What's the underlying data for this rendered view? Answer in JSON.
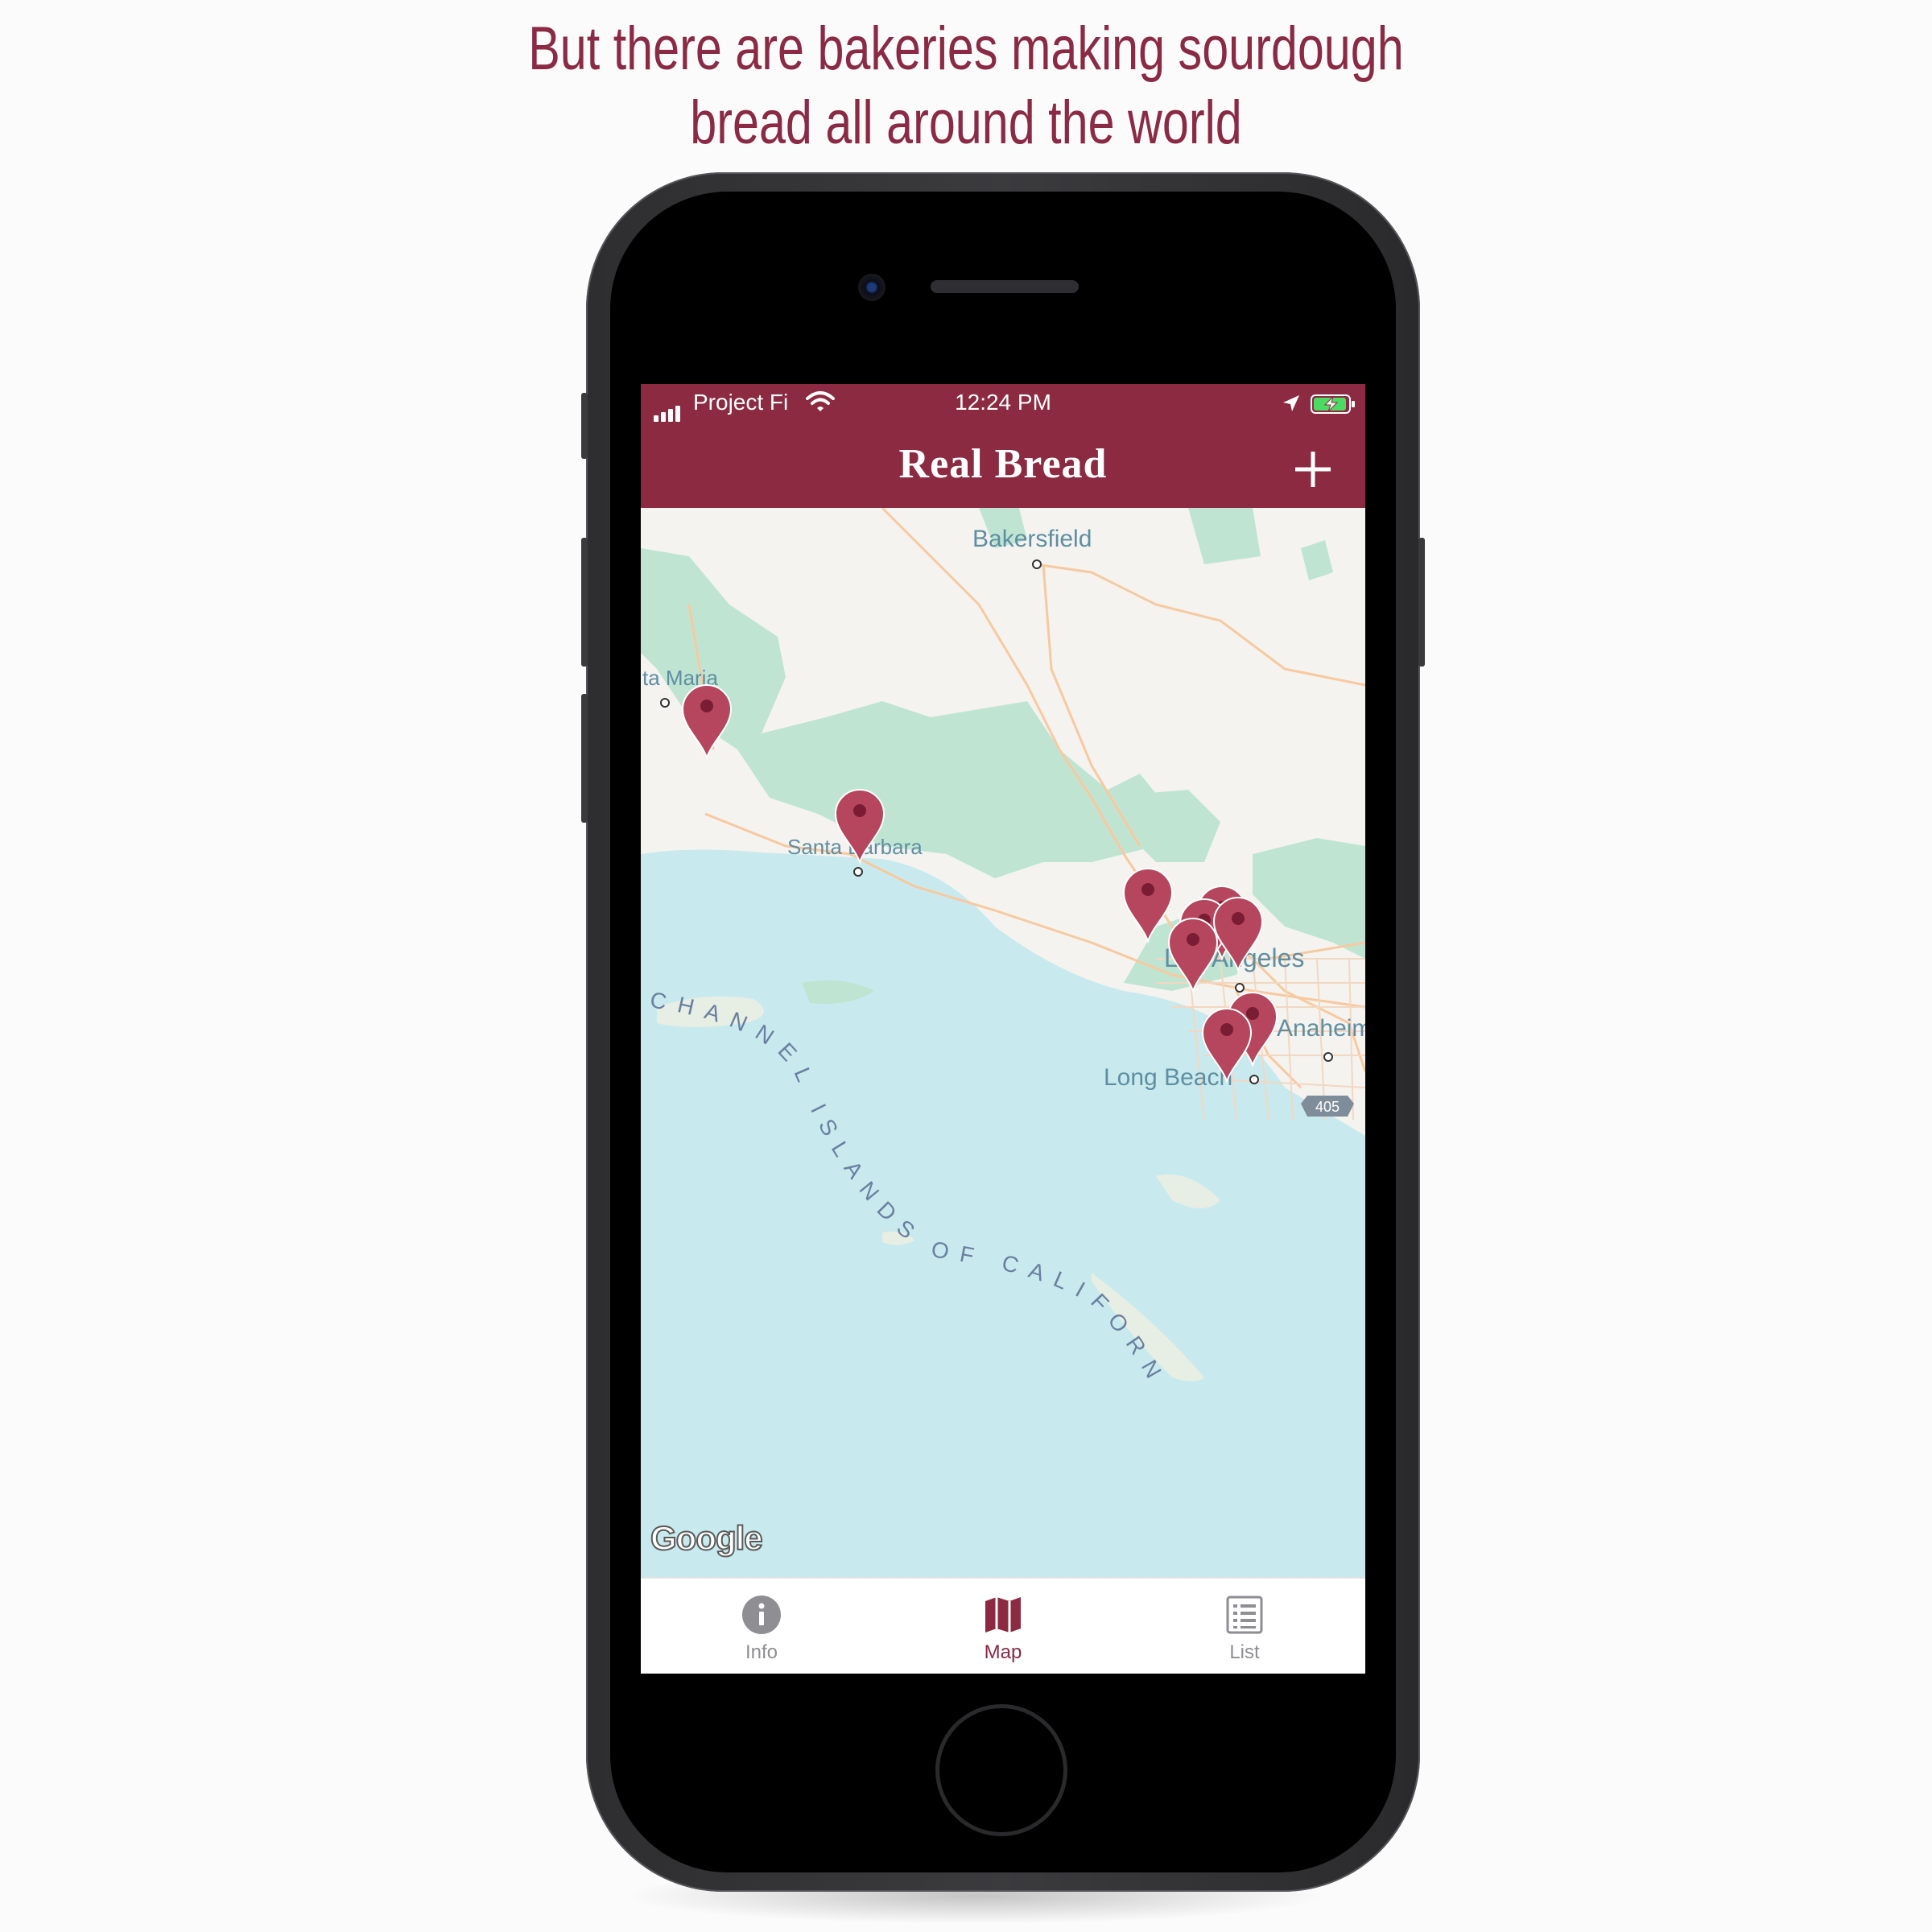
{
  "headline": {
    "line1": "But there are bakeries making sourdough",
    "line2": "bread all around the world"
  },
  "status_bar": {
    "carrier": "Project Fi",
    "time": "12:24 PM",
    "icons": [
      "signal-icon",
      "wifi-icon",
      "location-arrow-icon",
      "battery-charging-icon"
    ]
  },
  "nav": {
    "title": "Real Bread",
    "add_icon": "plus-icon"
  },
  "map": {
    "labels": {
      "bakersfield": "Bakersfield",
      "santa_maria": "ta Maria",
      "santa_barbara": "Santa Barbara",
      "los_angeles": "Los Angeles",
      "anaheim": "Anaheim",
      "long_beach": "Long Beach",
      "highway": "405",
      "channel_islands": "CHANNEL ISLANDS OF CALIFORNIA"
    },
    "attribution": "Google",
    "marker_color": "#b5465e",
    "marker_count": 9
  },
  "tabs": [
    {
      "label": "Info",
      "icon": "info-icon",
      "active": false
    },
    {
      "label": "Map",
      "icon": "map-icon",
      "active": true
    },
    {
      "label": "List",
      "icon": "list-icon",
      "active": false
    }
  ],
  "colors": {
    "brand": "#8b2a41",
    "headline": "#8b2a45",
    "water": "#c8eaee",
    "land": "#f4f3ef",
    "parks": "#bfe5d2",
    "roads": "#f8c9a0"
  }
}
